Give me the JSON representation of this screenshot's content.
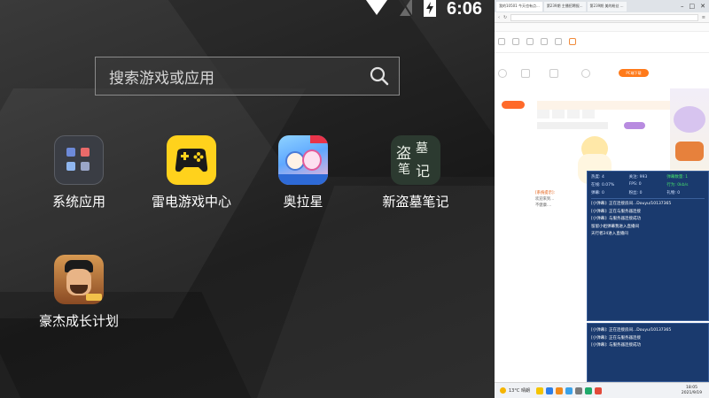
{
  "statusbar": {
    "time": "6:06"
  },
  "search": {
    "placeholder": "搜索游戏或应用"
  },
  "apps": [
    {
      "label": "系统应用"
    },
    {
      "label": "雷电游戏中心"
    },
    {
      "label": "奥拉星"
    },
    {
      "label": "新盗墓笔记"
    },
    {
      "label": "豪杰成长计划"
    }
  ],
  "icon_text": {
    "daomu_1": "盗",
    "daomu_2": "墓",
    "daomu_3": "笔",
    "daomu_4": "记"
  },
  "desktop": {
    "tabs": [
      "我的10501 今天也有点...",
      "第239期 主播招聘报...",
      "第239期 美的粉丝 ..."
    ],
    "pc_button": "PC端下载",
    "chat_lines": [
      "[系统提示]:",
      "欢迎来到...",
      "不健康....",
      "[小直弹]: 正在连接房间...Douyu/10137365"
    ],
    "panel": {
      "stats": [
        {
          "k": "热度:",
          "v": "4"
        },
        {
          "k": "关注:",
          "v": "993"
        },
        {
          "k": "弹幕数量:",
          "v": "1"
        },
        {
          "k": "在线:",
          "v": "0.07%"
        },
        {
          "k": "FPS:",
          "v": "0"
        },
        {
          "k": "行为:",
          "v": "0kb/s"
        },
        {
          "k": "弹幕:",
          "v": "0"
        },
        {
          "k": "粉丝:",
          "v": "0"
        },
        {
          "k": "礼物:",
          "v": "0"
        }
      ],
      "log": [
        "[小弹幕]: 正在连接房间...Douyu/10137365",
        "[小弹幕]: 正在与服务器连接",
        "[小弹幕]: 与服务器连接成功",
        "留留小姐弹幕我进入直播间",
        "天行者24进入直播间"
      ],
      "log2": [
        "[小弹幕]: 正在连接房间...Douyu/10137365",
        "[小弹幕]: 正在与服务器连接",
        "[小弹幕]: 与服务器连接成功"
      ]
    },
    "taskbar": {
      "temp": "13°C",
      "weather": "晴朗",
      "time": "18:05",
      "date": "2021/9/19"
    }
  }
}
